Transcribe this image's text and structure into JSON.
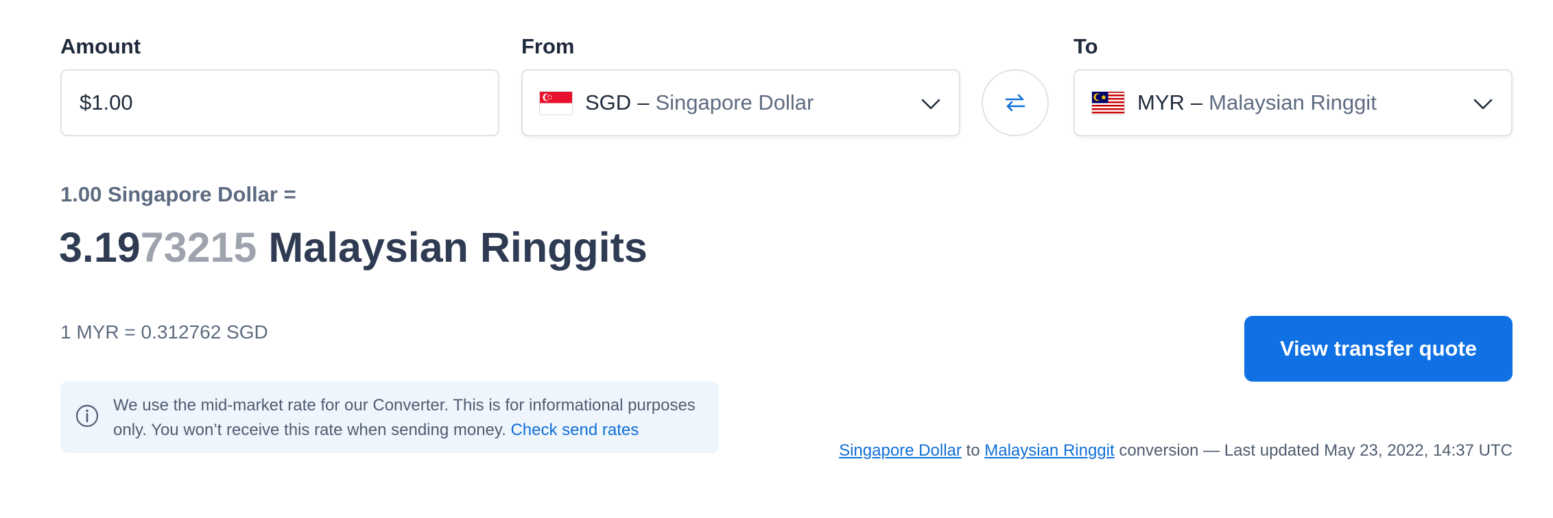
{
  "amount": {
    "label": "Amount",
    "value": "$1.00"
  },
  "from": {
    "label": "From",
    "code": "SGD",
    "dash": "–",
    "name": "Singapore Dollar",
    "flag_icon": "singapore-flag-icon"
  },
  "to": {
    "label": "To",
    "code": "MYR",
    "dash": "–",
    "name": "Malaysian Ringgit",
    "flag_icon": "malaysia-flag-icon"
  },
  "swap": {
    "icon": "swap-arrows-icon"
  },
  "result": {
    "from_line": "1.00 Singapore Dollar =",
    "value_bold": "3.19",
    "value_dim": "73215",
    "unit": "Malaysian Ringgits",
    "inverse": "1 MYR = 0.312762 SGD"
  },
  "info": {
    "icon": "info-icon",
    "text": "We use the mid-market rate for our Converter. This is for informational purposes only. You won’t receive this rate when sending money.",
    "link": "Check send rates"
  },
  "cta": {
    "label": "View transfer quote"
  },
  "footnote": {
    "from_link": "Singapore Dollar",
    "to_word": "to",
    "to_link": "Malaysian Ringgit",
    "suffix": "conversion — Last updated May 23, 2022, 14:37 UTC"
  },
  "colors": {
    "accent": "#0f71e4",
    "link": "#0f6fd6",
    "text_dark": "#1e2a3b",
    "text_muted": "#5d6b80",
    "info_bg": "#eff5fd"
  }
}
